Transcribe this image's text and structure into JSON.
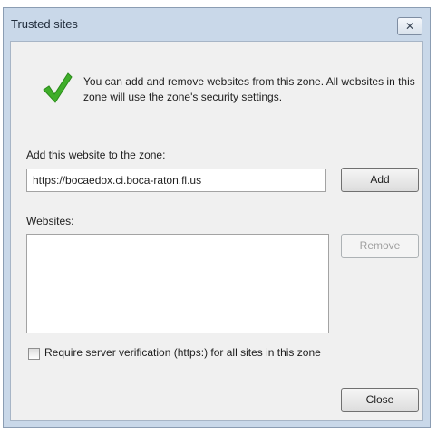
{
  "window": {
    "title": "Trusted sites",
    "close_glyph": "✕"
  },
  "message": "You can add and remove websites from this zone. All websites in this zone will use the zone's security settings.",
  "add_section": {
    "label": "Add this website to the zone:",
    "value": "https://bocaedox.ci.boca-raton.fl.us",
    "add_label": "Add"
  },
  "websites": {
    "label": "Websites:",
    "remove_label": "Remove",
    "items": []
  },
  "https_option": {
    "label": "Require server verification (https:) for all sites in this zone",
    "checked": false
  },
  "close_label": "Close",
  "colors": {
    "accent_check": "#3fae2a",
    "frame": "#c9d8e9",
    "client": "#f0f0f0"
  },
  "icons": {
    "status": "check-icon"
  }
}
